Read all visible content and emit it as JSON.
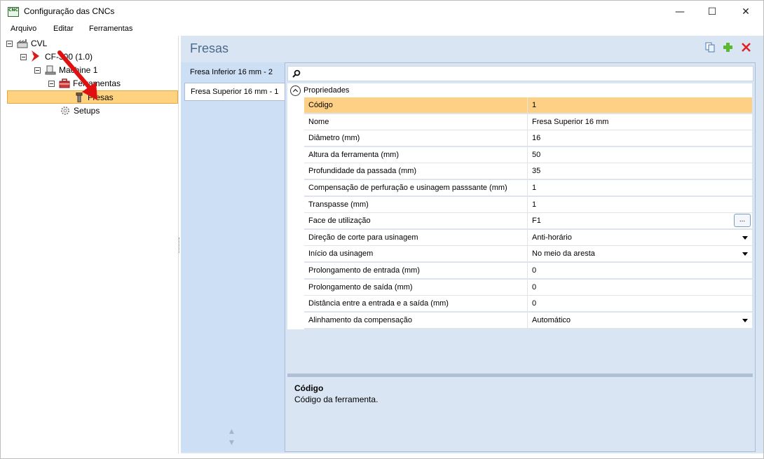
{
  "window": {
    "title": "Configuração das CNCs",
    "icon_label": "CNC",
    "controls": {
      "minimize": "—",
      "maximize": "☐",
      "close": "✕"
    }
  },
  "menu": [
    "Arquivo",
    "Editar",
    "Ferramentas"
  ],
  "tree": {
    "root": "CVL",
    "cnc": "CF-300 (1.0)",
    "machine": "Machine 1",
    "tools_group": "Ferramentas",
    "selected_leaf": "Fresas",
    "setups": "Setups"
  },
  "section": {
    "title": "Fresas",
    "toolbar_icons": [
      "copy-icon",
      "add-icon",
      "delete-icon"
    ]
  },
  "tool_list": [
    {
      "label": "Fresa Inferior 16 mm - 2",
      "selected": false
    },
    {
      "label": "Fresa Superior 16 mm - 1",
      "selected": true
    }
  ],
  "property_grid": {
    "search_placeholder": "",
    "category": "Propriedades",
    "rows": [
      {
        "name": "Código",
        "value": "1",
        "editor": "text",
        "selected": true
      },
      {
        "name": "Nome",
        "value": "Fresa Superior 16 mm",
        "editor": "text"
      },
      {
        "name": "Diâmetro (mm)",
        "value": "16",
        "editor": "text"
      },
      {
        "name": "Altura da ferramenta (mm)",
        "value": "50",
        "editor": "text"
      },
      {
        "name": "Profundidade da passada (mm)",
        "value": "35",
        "editor": "text"
      },
      {
        "name": "Compensação de perfuração e usinagem passsante (mm)",
        "value": "1",
        "editor": "text"
      },
      {
        "name": "Transpasse (mm)",
        "value": "1",
        "editor": "text"
      },
      {
        "name": "Face de utilização",
        "value": "F1",
        "editor": "ellipsis",
        "button_label": "..."
      },
      {
        "name": "Direção de corte para usinagem",
        "value": "Anti-horário",
        "editor": "dropdown"
      },
      {
        "name": "Início da usinagem",
        "value": "No meio da aresta",
        "editor": "dropdown"
      },
      {
        "name": "Prolongamento de entrada (mm)",
        "value": "0",
        "editor": "text"
      },
      {
        "name": "Prolongamento de saída (mm)",
        "value": "0",
        "editor": "text"
      },
      {
        "name": "Distância entre a entrada e a saída (mm)",
        "value": "0",
        "editor": "text"
      },
      {
        "name": "Alinhamento da compensação",
        "value": "Automático",
        "editor": "dropdown"
      }
    ]
  },
  "description": {
    "title": "Código",
    "text": "Código da ferramenta."
  },
  "colors": {
    "selection": "#fdd085",
    "panel_bg": "#dae5f3",
    "accent_title": "#4a6a8a",
    "annotation_arrow": "#e01010"
  }
}
